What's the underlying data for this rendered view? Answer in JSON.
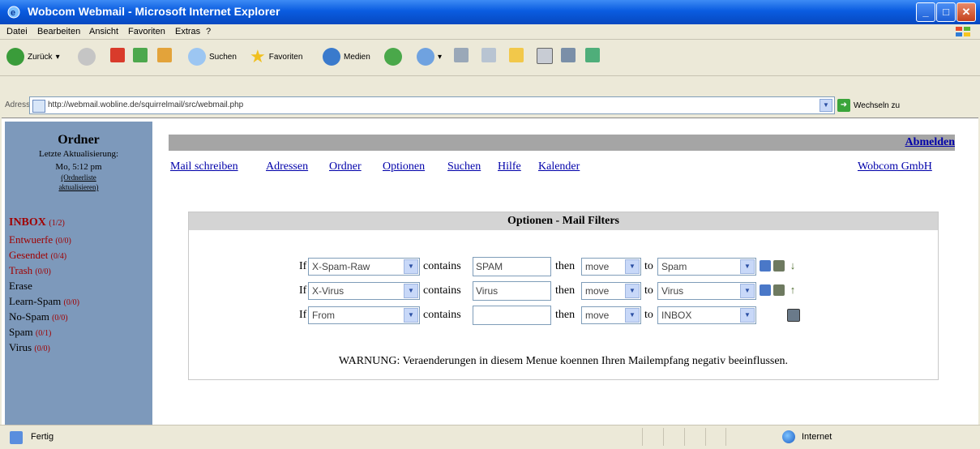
{
  "window": {
    "title": "Wobcom Webmail - Microsoft Internet Explorer"
  },
  "menu": [
    "Datei",
    "Bearbeiten",
    "Ansicht",
    "Favoriten",
    "Extras",
    "?"
  ],
  "toolbar": {
    "back": "Zurück",
    "search": "Suchen",
    "favorites": "Favoriten",
    "media": "Medien"
  },
  "address": {
    "label": "Adresse",
    "url": "http://webmail.wobline.de/squirrelmail/src/webmail.php",
    "go": "Wechseln zu"
  },
  "sidebar": {
    "heading": "Ordner",
    "last_update_label": "Letzte Aktualisierung:",
    "last_update_time": "Mo, 5:12 pm",
    "refresh_line1": "(Ordnerliste",
    "refresh_line2": "aktualisieren)",
    "folders": [
      {
        "name": "INBOX",
        "count": "(1/2)"
      },
      {
        "name": "Entwuerfe",
        "count": "(0/0)"
      },
      {
        "name": "Gesendet",
        "count": "(0/4)"
      },
      {
        "name": "Trash",
        "count": "(0/0)"
      },
      {
        "name": "Erase",
        "count": ""
      },
      {
        "name": "Learn-Spam",
        "count": "(0/0)"
      },
      {
        "name": "No-Spam",
        "count": "(0/0)"
      },
      {
        "name": "Spam",
        "count": "(0/1)"
      },
      {
        "name": "Virus",
        "count": "(0/0)"
      }
    ]
  },
  "main": {
    "logout": "Abmelden",
    "nav": [
      "Mail schreiben",
      "Adressen",
      "Ordner",
      "Optionen",
      "Suchen",
      "Hilfe",
      "Kalender"
    ],
    "company": "Wobcom GmbH",
    "panel_title": "Optionen - Mail Filters",
    "labels": {
      "if": "If",
      "contains": "contains",
      "then": "then",
      "to": "to"
    },
    "filters": [
      {
        "field": "X-Spam-Raw",
        "value": "SPAM",
        "action": "move",
        "target": "Spam"
      },
      {
        "field": "X-Virus",
        "value": "Virus",
        "action": "move",
        "target": "Virus"
      },
      {
        "field": "From",
        "value": "",
        "action": "move",
        "target": "INBOX"
      }
    ],
    "warning": "WARNUNG: Veraenderungen in diesem Menue koennen Ihren Mailempfang negativ beeinflussen."
  },
  "status": {
    "text": "Fertig",
    "zone": "Internet"
  }
}
